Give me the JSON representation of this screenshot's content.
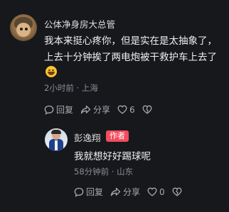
{
  "comment": {
    "username": "公体净身房大总管",
    "text": "我本来挺心疼你，但是实在是太抽象了，上去十分钟挨了两电炮被干救护车上去了",
    "emoji": "laughing-emoji",
    "time": "2小时前",
    "location": "上海",
    "actions": {
      "reply_label": "回复",
      "share_label": "分享",
      "like_count": "6"
    }
  },
  "reply": {
    "username": "彭逸翔",
    "badge": "作者",
    "text": "我就想好好踢球呢",
    "time": "58分钟前",
    "location": "山东",
    "actions": {
      "reply_label": "回复",
      "share_label": "分享",
      "like_count": "0"
    }
  },
  "colors": {
    "background": "#16181c",
    "author_badge": "#f24d5e",
    "meta_text": "#8a8d93"
  }
}
